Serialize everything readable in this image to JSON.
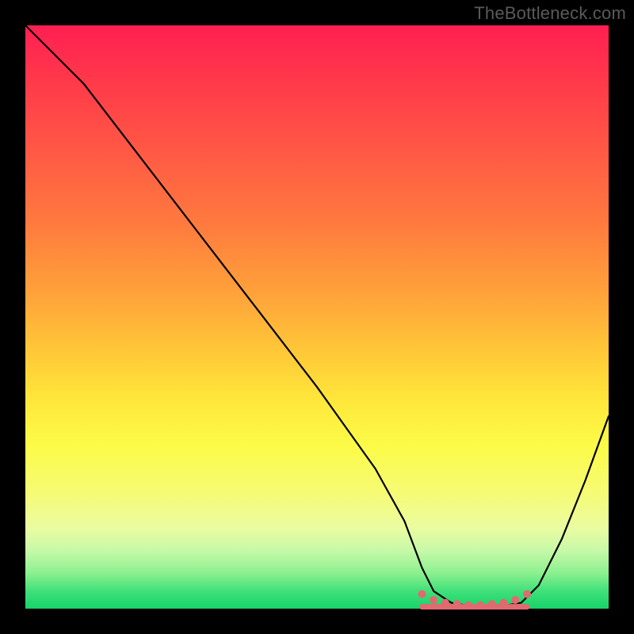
{
  "watermark": "TheBottleneck.com",
  "colors": {
    "background": "#000000",
    "curve": "#000000",
    "marker": "#e06a6f",
    "gradient_top": "#ff1f52",
    "gradient_bottom": "#17d36a"
  },
  "chart_data": {
    "type": "line",
    "title": "",
    "xlabel": "",
    "ylabel": "",
    "xlim": [
      0,
      100
    ],
    "ylim": [
      0,
      100
    ],
    "x": [
      0,
      4,
      10,
      20,
      30,
      40,
      50,
      60,
      65,
      68,
      70,
      73,
      76,
      79,
      82,
      85,
      88,
      92,
      96,
      100
    ],
    "values": [
      100,
      96,
      90,
      77,
      64,
      51,
      38,
      24,
      15,
      7,
      3,
      1,
      0.5,
      0.5,
      0.5,
      1,
      4,
      12,
      22,
      33
    ],
    "markers_x": [
      68,
      70,
      72,
      74,
      76,
      78,
      80,
      82,
      84,
      86
    ],
    "markers_y": [
      2.5,
      1.5,
      1,
      0.8,
      0.6,
      0.6,
      0.8,
      1,
      1.5,
      2.5
    ],
    "annotations": []
  }
}
